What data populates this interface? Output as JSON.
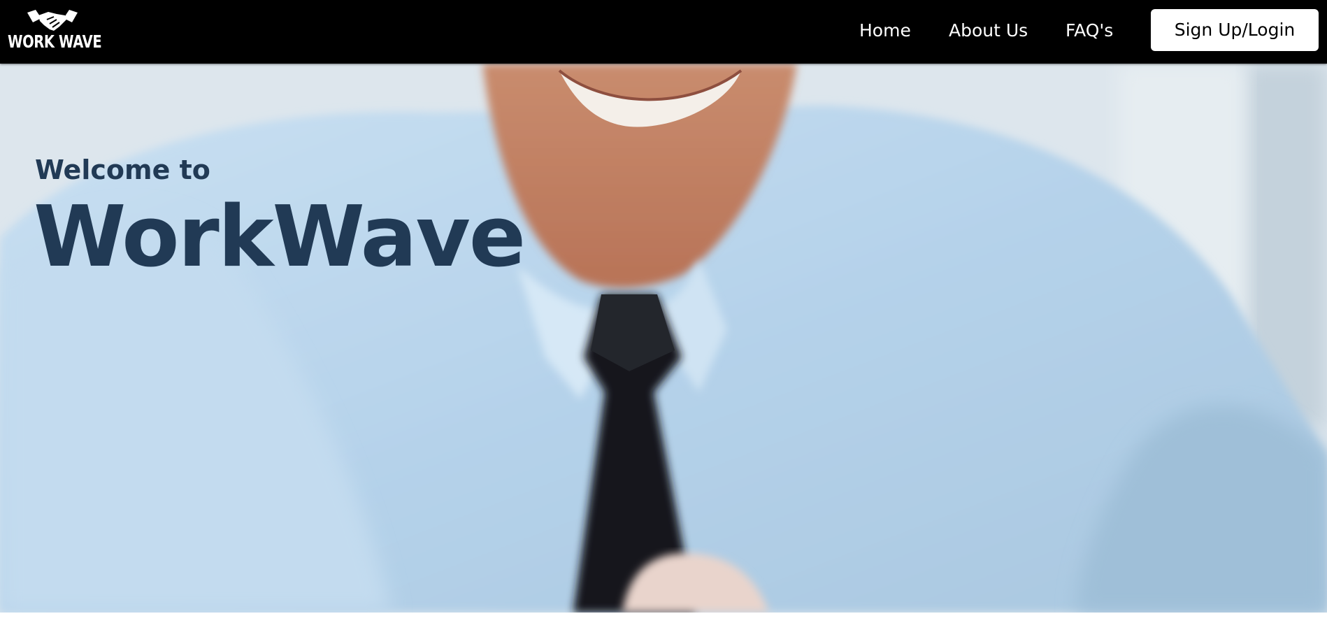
{
  "navbar": {
    "logo": {
      "text": "WORK WAVE",
      "icon": "handshake-icon"
    },
    "links": [
      {
        "label": "Home"
      },
      {
        "label": "About Us"
      },
      {
        "label": "FAQ's"
      }
    ],
    "signup_label": "Sign Up/Login"
  },
  "hero": {
    "welcome": "Welcome to",
    "title": "WorkWave",
    "image": "smiling-businessman-blue-shirt-black-tie"
  },
  "colors": {
    "navbar_bg": "#000000",
    "nav_text": "#ffffff",
    "heading": "#213a55",
    "button_bg": "#ffffff"
  }
}
